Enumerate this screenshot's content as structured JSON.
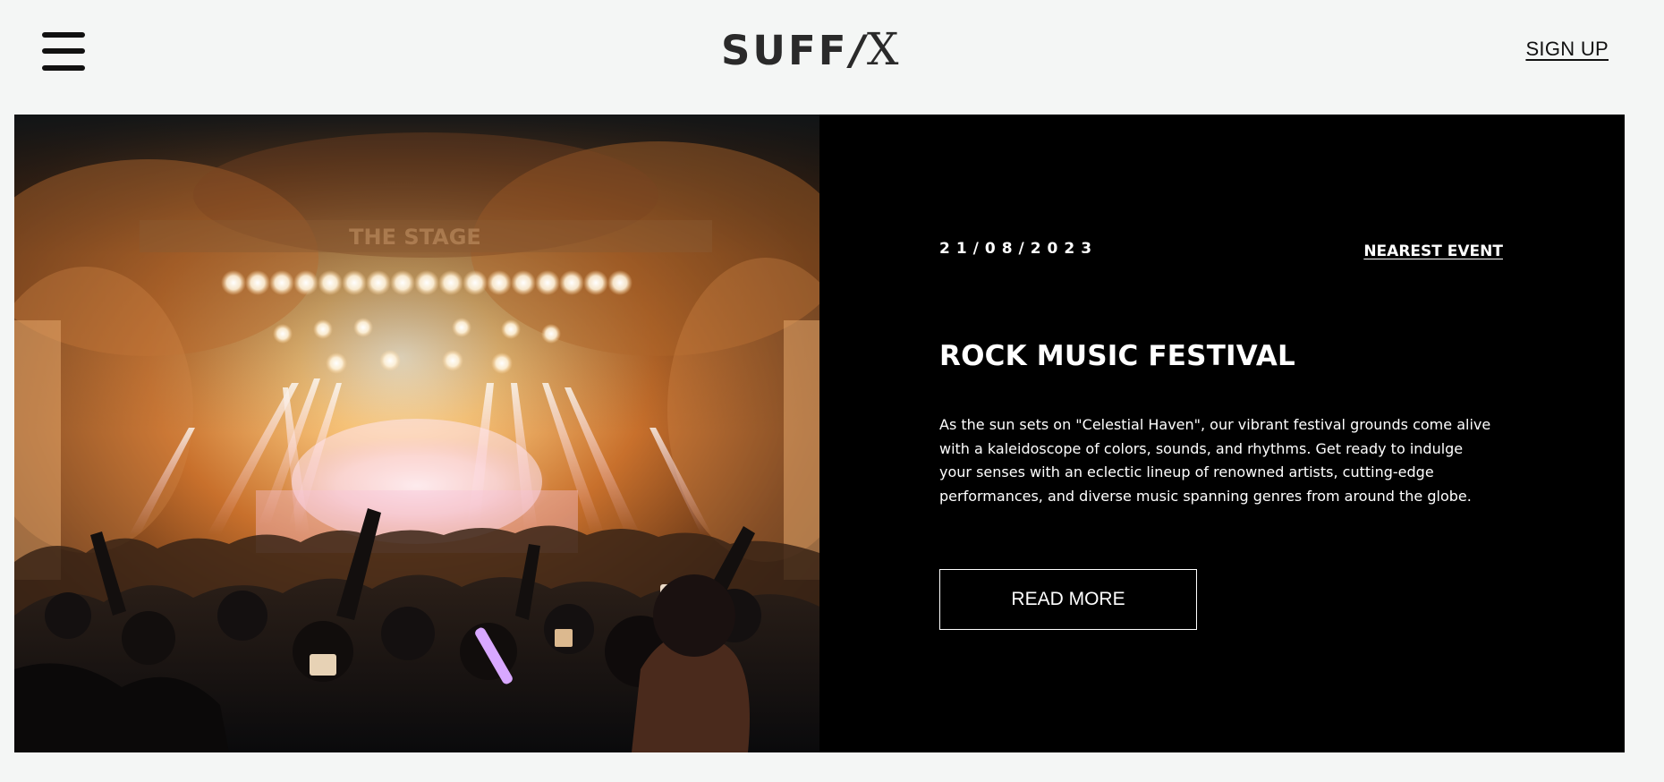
{
  "header": {
    "logo_main": "SUFF",
    "logo_slash": "/",
    "logo_x": "X",
    "signup_label": "SIGN UP",
    "menu_icon": "hamburger-menu-icon"
  },
  "hero": {
    "image_sign_text": "THE STAGE",
    "event": {
      "date": "21/08/2023",
      "nearest_label": "NEAREST EVENT",
      "title": "ROCK MUSIC FESTIVAL",
      "description": "As the sun sets on \"Celestial Haven\", our vibrant festival grounds come alive with a kaleidoscope of colors, sounds, and rhythms. Get ready to indulge your senses with an eclectic lineup of renowned artists, cutting-edge performances, and diverse music spanning genres from around the globe.",
      "read_more_label": "READ MORE"
    }
  },
  "colors": {
    "page_background": "#f4f6f5",
    "panel_background": "#000000",
    "text_dark": "#111111",
    "text_light": "#ffffff",
    "stage_glow": "#f3a54a"
  }
}
